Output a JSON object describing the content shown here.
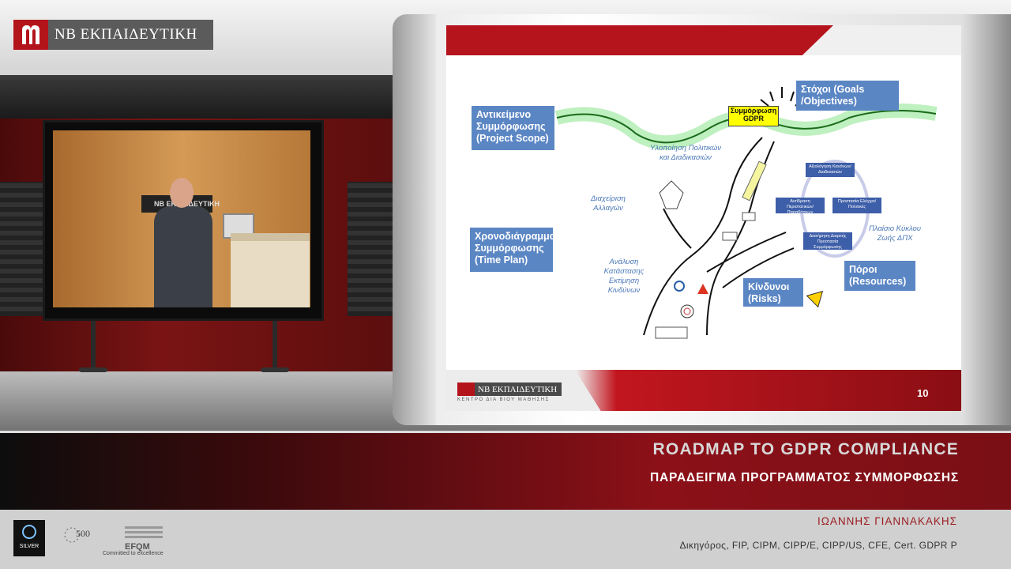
{
  "brand": {
    "name": "ΝΒ ΕΚΠΑΙΔΕΥΤΙΚΗ",
    "accent": "#b3131b"
  },
  "tv": {
    "podium_sign": "ΝΒ ΕΚΠΑΙΔΕΥΤΙΚΗ"
  },
  "slide": {
    "logo_text": "ΝΒ ΕΚΠΑΙΔΕΥΤΙΚΗ",
    "logo_sub": "ΚΕΝΤΡΟ ΔΙΑ ΒΙΟΥ ΜΑΘΗΣΗΣ",
    "page_number": "10",
    "boxes": {
      "scope": "Αντικείμενο Συμμόρφωσης (Project Scope)",
      "objectives": "Στόχοι (Goals /Objectives)",
      "timeplan": "Χρονοδιάγραμμα Συμμόρφωσης (Time Plan)",
      "risks": "Κίνδυνοι (Risks)",
      "resources": "Πόροι (Resources)"
    },
    "flag": "Συμμόρφωση GDPR",
    "labels": {
      "policies": "Υλοποίηση Πολιτικών και Διαδικασιών",
      "changes": "Διαχείριση Αλλαγών",
      "analysis": "Ανάλυση Κατάστασης Εκτίμηση Κινδύνων",
      "lifecycle": "Πλαίσιο Κύκλου Ζωής ΔΠΧ"
    },
    "cycle": {
      "evaluation": "Αξιολόγηση Κανόνων/Διαδικασιών",
      "reaction": "Αντίδραση Περιστατικών/Παραβάσεων",
      "protection": "Προστασία Ελέγχοι/Πολιτικές",
      "maintenance": "Διατήρηση Διαρκής Προστασία Συμμόρφωσης"
    }
  },
  "lower_third": {
    "title": "ROADMAP TO GDPR COMPLIANCE",
    "subtitle": "ΠΑΡΑΔΕΙΓΜΑ ΠΡΟΓΡΑΜΜΑΤΟΣ ΣΥΜΜΟΡΦΩΣΗΣ",
    "presenter": "ΙΩΑΝΝΗΣ ΓΙΑΝΝΑΚΑΚΗΣ",
    "credentials": "Δικηγόρος, FIP, CIPM, CIPP/E, CIPP/US, CFE, Cert. GDPR P"
  },
  "badges": {
    "silver": "SILVER",
    "recognised": "500",
    "efqm": "EFQM",
    "efqm_sub": "Committed to excellence"
  }
}
